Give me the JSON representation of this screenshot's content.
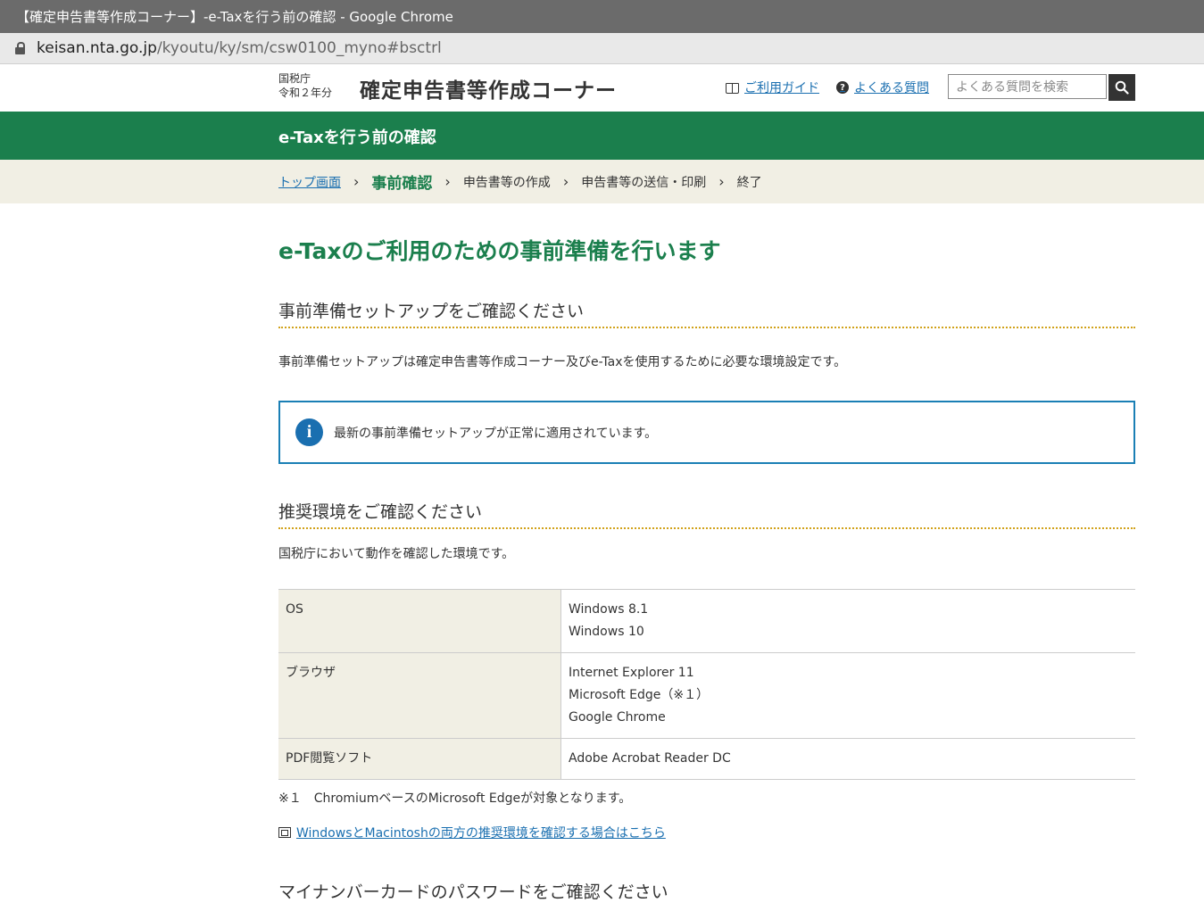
{
  "browser": {
    "window_title": "【確定申告書等作成コーナー】-e-Taxを行う前の確認 - Google Chrome",
    "url_host": "keisan.nta.go.jp",
    "url_path": "/kyoutu/ky/sm/csw0100_myno#bsctrl"
  },
  "header": {
    "agency": "国税庁",
    "year": "令和２年分",
    "site_title": "確定申告書等作成コーナー",
    "guide_link": "ご利用ガイド",
    "faq_link": "よくある質問",
    "faq_icon_glyph": "?",
    "search_placeholder": "よくある質問を検索"
  },
  "banner": {
    "title": "e-Taxを行う前の確認"
  },
  "breadcrumb": {
    "top": "トップ画面",
    "current": "事前確認",
    "step2": "申告書等の作成",
    "step3": "申告書等の送信・印刷",
    "step4": "終了",
    "separator": "›"
  },
  "main": {
    "heading": "e-Taxのご利用のための事前準備を行います",
    "section1": {
      "title": "事前準備セットアップをご確認ください",
      "description": "事前準備セットアップは確定申告書等作成コーナー及びe-Taxを使用するために必要な環境設定です。",
      "info_icon_glyph": "i",
      "info_message": "最新の事前準備セットアップが正常に適用されています。"
    },
    "section2": {
      "title": "推奨環境をご確認ください",
      "description": "国税庁において動作を確認した環境です。",
      "rows": [
        {
          "label": "OS",
          "values": [
            "Windows 8.1",
            "Windows 10"
          ]
        },
        {
          "label": "ブラウザ",
          "values": [
            "Internet Explorer 11",
            "Microsoft Edge（※１）",
            "Google Chrome"
          ]
        },
        {
          "label": "PDF閲覧ソフト",
          "values": [
            "Adobe Acrobat Reader DC"
          ]
        }
      ],
      "note": "※１　ChromiumベースのMicrosoft Edgeが対象となります。",
      "link": "WindowsとMacintoshの両方の推奨環境を確認する場合はこちら"
    },
    "section3": {
      "title": "マイナンバーカードのパスワードをご確認ください"
    }
  },
  "colors": {
    "brand_green": "#1b7f4d",
    "link_blue": "#1a6fb0",
    "dotted_rule": "#d1a21a",
    "table_label_bg": "#f1efe4"
  }
}
